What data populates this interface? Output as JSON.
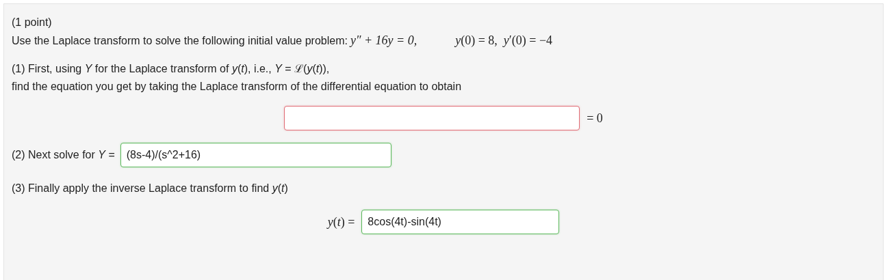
{
  "header": "(1 point)",
  "problem": {
    "text": "Use the Laplace transform to solve the following initial value problem:",
    "equation": "y″ + 16y = 0,",
    "conditions": "*y*(0) = 8,  *y*′(0) = −4"
  },
  "parts": [
    {
      "kind": "centered",
      "lines": [
        "(1) First, using *Y* for the Laplace transform of *y*(*t*), i.e., *Y* = ℒ(*y*(*t*)),",
        "find the equation you get by taking the Laplace transform of the differential equation to obtain"
      ],
      "field": {
        "correct": false
      },
      "suffix": "= 0"
    },
    {
      "kind": "inline",
      "label": "(2) Next solve for *Y* =",
      "field": {
        "value": "(8s-4)/(s^2+16)",
        "correct": true
      }
    },
    {
      "kind": "centered",
      "lines": [
        "(3) Finally apply the inverse Laplace transform to find *y*(*t*)"
      ],
      "prefix": "*y*(*t*) =",
      "field": {
        "value": "8cos(4t)-sin(4t)",
        "correct": true
      }
    }
  ]
}
